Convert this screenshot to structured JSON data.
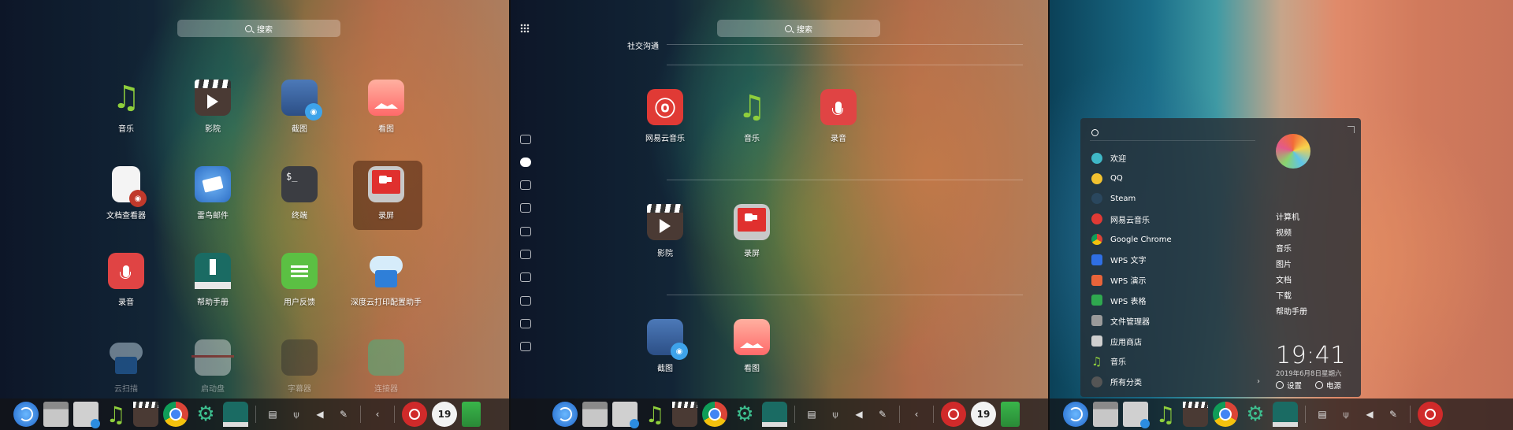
{
  "launcher_grid": {
    "search_label": "搜索",
    "apps": [
      {
        "label": "音乐"
      },
      {
        "label": "影院"
      },
      {
        "label": "截图"
      },
      {
        "label": "看图"
      },
      {
        "label": "文档查看器"
      },
      {
        "label": "雷鸟邮件"
      },
      {
        "label": "终端"
      },
      {
        "label": "录屏"
      },
      {
        "label": "录音"
      },
      {
        "label": "帮助手册"
      },
      {
        "label": "用户反馈"
      },
      {
        "label": "深度云打印配置助手"
      },
      {
        "label": "云扫描"
      },
      {
        "label": "启动盘"
      },
      {
        "label": "字幕器"
      },
      {
        "label": "连接器"
      }
    ]
  },
  "launcher_category": {
    "search_label": "搜索",
    "category_title": "社交沟通",
    "apps": [
      {
        "label": "网易云音乐"
      },
      {
        "label": "音乐"
      },
      {
        "label": "录音"
      },
      {
        "label": "影院"
      },
      {
        "label": "录屏"
      },
      {
        "label": "截图"
      },
      {
        "label": "看图"
      }
    ]
  },
  "start_menu": {
    "apps": [
      {
        "label": "欢迎",
        "color": "#3fb8c7"
      },
      {
        "label": "QQ",
        "color": "#f2c230"
      },
      {
        "label": "Steam",
        "color": "#2a475e"
      },
      {
        "label": "网易云音乐",
        "color": "#e03a35"
      },
      {
        "label": "Google Chrome",
        "color": "#4285f4"
      },
      {
        "label": "WPS 文字",
        "color": "#2f6fe4"
      },
      {
        "label": "WPS 演示",
        "color": "#e8643a"
      },
      {
        "label": "WPS 表格",
        "color": "#2fa84f"
      },
      {
        "label": "文件管理器",
        "color": "#9a9a9a"
      },
      {
        "label": "应用商店",
        "color": "#cfcfcf"
      },
      {
        "label": "音乐",
        "color": "#8fcf3c"
      },
      {
        "label": "所有分类",
        "color": "#555555"
      }
    ],
    "all_categories_arrow": "›",
    "places": [
      "计算机",
      "视频",
      "音乐",
      "图片",
      "文档",
      "下载",
      "帮助手册"
    ],
    "clock": "19:41",
    "date": "2019年6月8日星期六",
    "settings_label": "设置",
    "power_label": "电源"
  },
  "dock": {
    "calendar_day_p1": "19",
    "calendar_day_p2": "19",
    "back_arrow": "‹"
  }
}
